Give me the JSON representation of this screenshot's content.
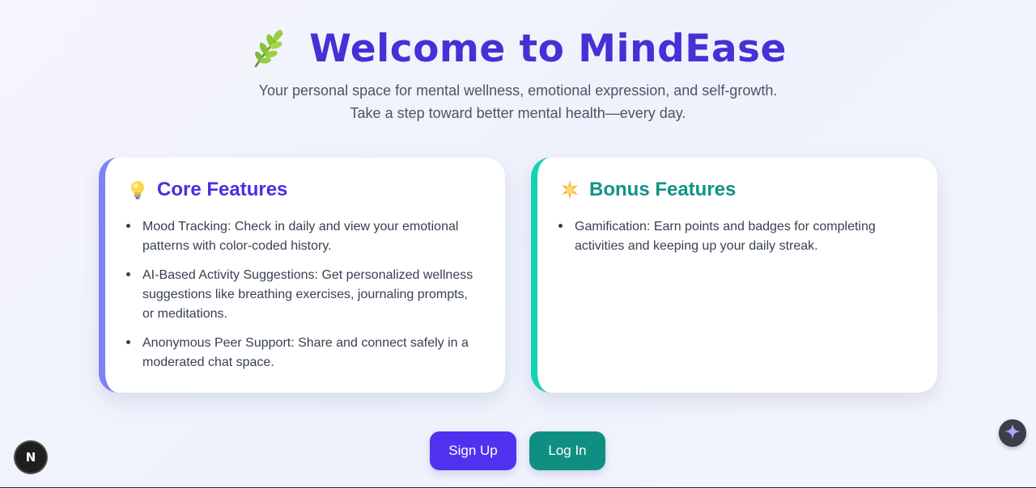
{
  "hero": {
    "title": "Welcome to MindEase",
    "title_icon": "herb-leaf-icon",
    "subtitle_line1": "Your personal space for mental wellness, emotional expression, and self-growth.",
    "subtitle_line2": "Take a step toward better mental health—every day."
  },
  "core": {
    "icon": "lightbulb-icon",
    "title": "Core Features",
    "items": [
      "Mood Tracking: Check in daily and view your emotional patterns with color-coded history.",
      "AI-Based Activity Suggestions: Get personalized wellness suggestions like breathing exercises, journaling prompts, or meditations.",
      "Anonymous Peer Support: Share and connect safely in a moderated chat space."
    ]
  },
  "bonus": {
    "icon": "sparkle-star-icon",
    "title": "Bonus Features",
    "items": [
      "Gamification: Earn points and badges for completing activities and keeping up your daily streak."
    ]
  },
  "actions": {
    "signup_label": "Sign Up",
    "login_label": "Log In"
  },
  "overlay": {
    "next_badge": "N"
  },
  "colors": {
    "title": "#4630d6",
    "core_accent": "#7c83f5",
    "bonus_accent": "#16d2b5",
    "signup_button": "#4f32f0",
    "login_button": "#0f8f82"
  }
}
